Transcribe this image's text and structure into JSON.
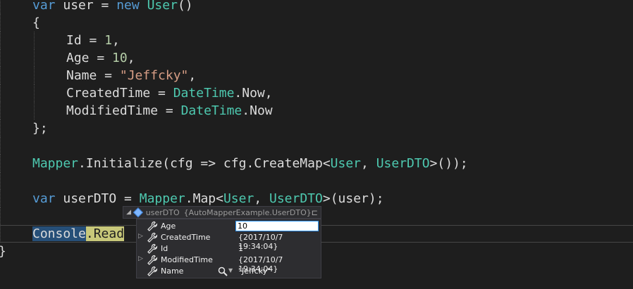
{
  "code_lines": [
    {
      "indent": 1,
      "tokens": [
        [
          "kw",
          "var"
        ],
        [
          "pl",
          " user = "
        ],
        [
          "kw",
          "new"
        ],
        [
          "pl",
          " "
        ],
        [
          "ty",
          "User"
        ],
        [
          "pl",
          "()"
        ]
      ]
    },
    {
      "indent": 1,
      "tokens": [
        [
          "pl",
          "{"
        ]
      ]
    },
    {
      "indent": 2,
      "tokens": [
        [
          "pl",
          "Id = "
        ],
        [
          "num",
          "1"
        ],
        [
          "pl",
          ","
        ]
      ]
    },
    {
      "indent": 2,
      "tokens": [
        [
          "pl",
          "Age = "
        ],
        [
          "num",
          "10"
        ],
        [
          "pl",
          ","
        ]
      ]
    },
    {
      "indent": 2,
      "tokens": [
        [
          "pl",
          "Name = "
        ],
        [
          "str",
          "\"Jeffcky\""
        ],
        [
          "pl",
          ","
        ]
      ]
    },
    {
      "indent": 2,
      "tokens": [
        [
          "pl",
          "CreatedTime = "
        ],
        [
          "ty",
          "DateTime"
        ],
        [
          "pl",
          ".Now,"
        ]
      ]
    },
    {
      "indent": 2,
      "tokens": [
        [
          "pl",
          "ModifiedTime = "
        ],
        [
          "ty",
          "DateTime"
        ],
        [
          "pl",
          ".Now"
        ]
      ]
    },
    {
      "indent": 1,
      "tokens": [
        [
          "pl",
          "};"
        ]
      ]
    },
    {
      "indent": 1,
      "tokens": []
    },
    {
      "indent": 1,
      "tokens": [
        [
          "ty",
          "Mapper"
        ],
        [
          "pl",
          ".Initialize(cfg => cfg.CreateMap<"
        ],
        [
          "ty",
          "User"
        ],
        [
          "pl",
          ", "
        ],
        [
          "ty",
          "UserDTO"
        ],
        [
          "pl",
          ">());"
        ]
      ]
    },
    {
      "indent": 1,
      "tokens": []
    },
    {
      "indent": 1,
      "tokens": [
        [
          "kw",
          "var"
        ],
        [
          "pl",
          " userDTO = "
        ],
        [
          "ty",
          "Mapper"
        ],
        [
          "pl",
          ".Map<"
        ],
        [
          "ty",
          "User"
        ],
        [
          "pl",
          ", "
        ],
        [
          "ty",
          "UserDTO"
        ],
        [
          "pl",
          ">(user);"
        ]
      ]
    },
    {
      "indent": 1,
      "tokens": []
    },
    {
      "indent": 1,
      "tokens": [
        [
          "hl-sel",
          "Console"
        ],
        [
          "hl-y",
          ".Read"
        ]
      ]
    },
    {
      "indent": 0,
      "tokens": [
        [
          "pl",
          "}"
        ]
      ]
    }
  ],
  "datatip": {
    "header_name": "userDTO",
    "header_type": "{AutoMapperExample.UserDTO}",
    "rows": [
      {
        "expandable": false,
        "name": "Age",
        "value": "10",
        "editing": true,
        "visualizer": false
      },
      {
        "expandable": true,
        "name": "CreatedTime",
        "value": "{2017/10/7 19:34:04}",
        "editing": false,
        "visualizer": false
      },
      {
        "expandable": false,
        "name": "Id",
        "value": "1",
        "editing": false,
        "visualizer": false
      },
      {
        "expandable": true,
        "name": "ModifiedTime",
        "value": "{2017/10/7 19:34:04}",
        "editing": false,
        "visualizer": false
      },
      {
        "expandable": false,
        "name": "Name",
        "value": "\"Jeffcky\"",
        "editing": false,
        "visualizer": true
      }
    ]
  },
  "icons": {
    "expander": "triangle-right-icon",
    "object": "object-icon",
    "property": "wrench-icon",
    "pin": "pin-icon",
    "visualizer": "magnifier-icon"
  },
  "colors": {
    "background": "#1e1e1e",
    "keyword": "#569cd6",
    "type": "#4ec9b0",
    "number": "#b5cea8",
    "string": "#d69d85"
  }
}
